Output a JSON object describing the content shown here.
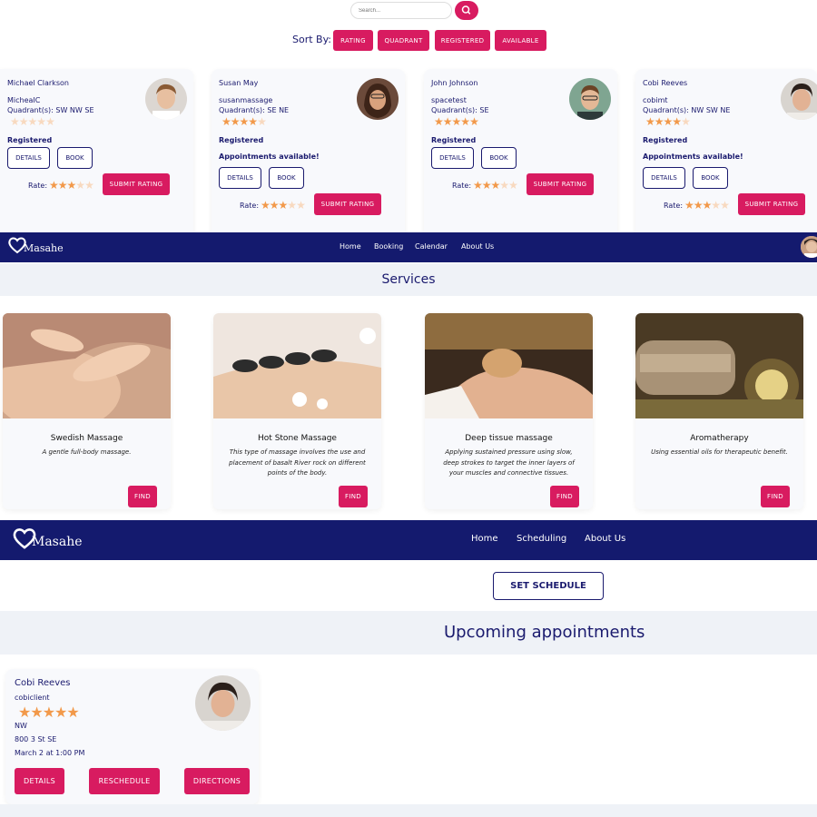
{
  "search": {
    "placeholder": "Search..."
  },
  "sort": {
    "label": "Sort By:",
    "options": [
      "RATING",
      "QUADRANT",
      "REGISTERED",
      "AVAILABLE"
    ]
  },
  "therapists": [
    {
      "name": "Michael Clarkson",
      "username": "MicheaIC",
      "quadrants": "Quadrant(s): SW  NW  SE",
      "rating": 0,
      "status": "Registered",
      "availability": "",
      "rate_label": "Rate:"
    },
    {
      "name": "Susan May",
      "username": "susanmassage",
      "quadrants": "Quadrant(s): SE  NE",
      "rating": 4,
      "status": "Registered",
      "availability": "Appointments available!",
      "rate_label": "Rate:"
    },
    {
      "name": "John Johnson",
      "username": "spacetest",
      "quadrants": "Quadrant(s): SE",
      "rating": 5,
      "status": "Registered",
      "availability": "",
      "rate_label": "Rate:"
    },
    {
      "name": "Cobi Reeves",
      "username": "cobimt",
      "quadrants": "Quadrant(s): NW  SW  NE",
      "rating": 4,
      "status": "Registered",
      "availability": "Appointments available!",
      "rate_label": "Rate:"
    }
  ],
  "card_buttons": {
    "details": "DETAILS",
    "book": "BOOK",
    "submit_rating": "SUBMIT RATING"
  },
  "rate_widget_value": 3,
  "nav1": {
    "brand": "Masahe",
    "links": [
      "Home",
      "Booking",
      "Calendar",
      "About Us"
    ]
  },
  "services": {
    "heading": "Services",
    "find_label": "FIND",
    "items": [
      {
        "title": "Swedish Massage",
        "desc": "A gentle full-body massage."
      },
      {
        "title": "Hot Stone Massage",
        "desc": "This type of massage involves the use and placement of basalt River rock on different points of the body."
      },
      {
        "title": "Deep tissue massage",
        "desc": "Applying sustained pressure using slow, deep strokes to target the inner layers of your muscles and connective tissues."
      },
      {
        "title": "Aromatherapy",
        "desc": "Using essential oils for therapeutic benefit."
      }
    ]
  },
  "nav2": {
    "brand": "Masahe",
    "links": [
      "Home",
      "Scheduling",
      "About Us"
    ]
  },
  "set_schedule": "SET SCHEDULE",
  "upcoming": {
    "heading": "Upcoming appointments",
    "name": "Cobi Reeves",
    "username": "cobiclient",
    "rating": 5,
    "quadrant": "NW",
    "address": "800 3 St SE",
    "datetime": "March 2 at 1:00 PM",
    "buttons": [
      "DETAILS",
      "RESCHEDULE",
      "DIRECTIONS"
    ]
  },
  "colors": {
    "navy": "#141a6e",
    "accent": "#d81b60",
    "star": "#f2994a",
    "band": "#eff2f7"
  }
}
